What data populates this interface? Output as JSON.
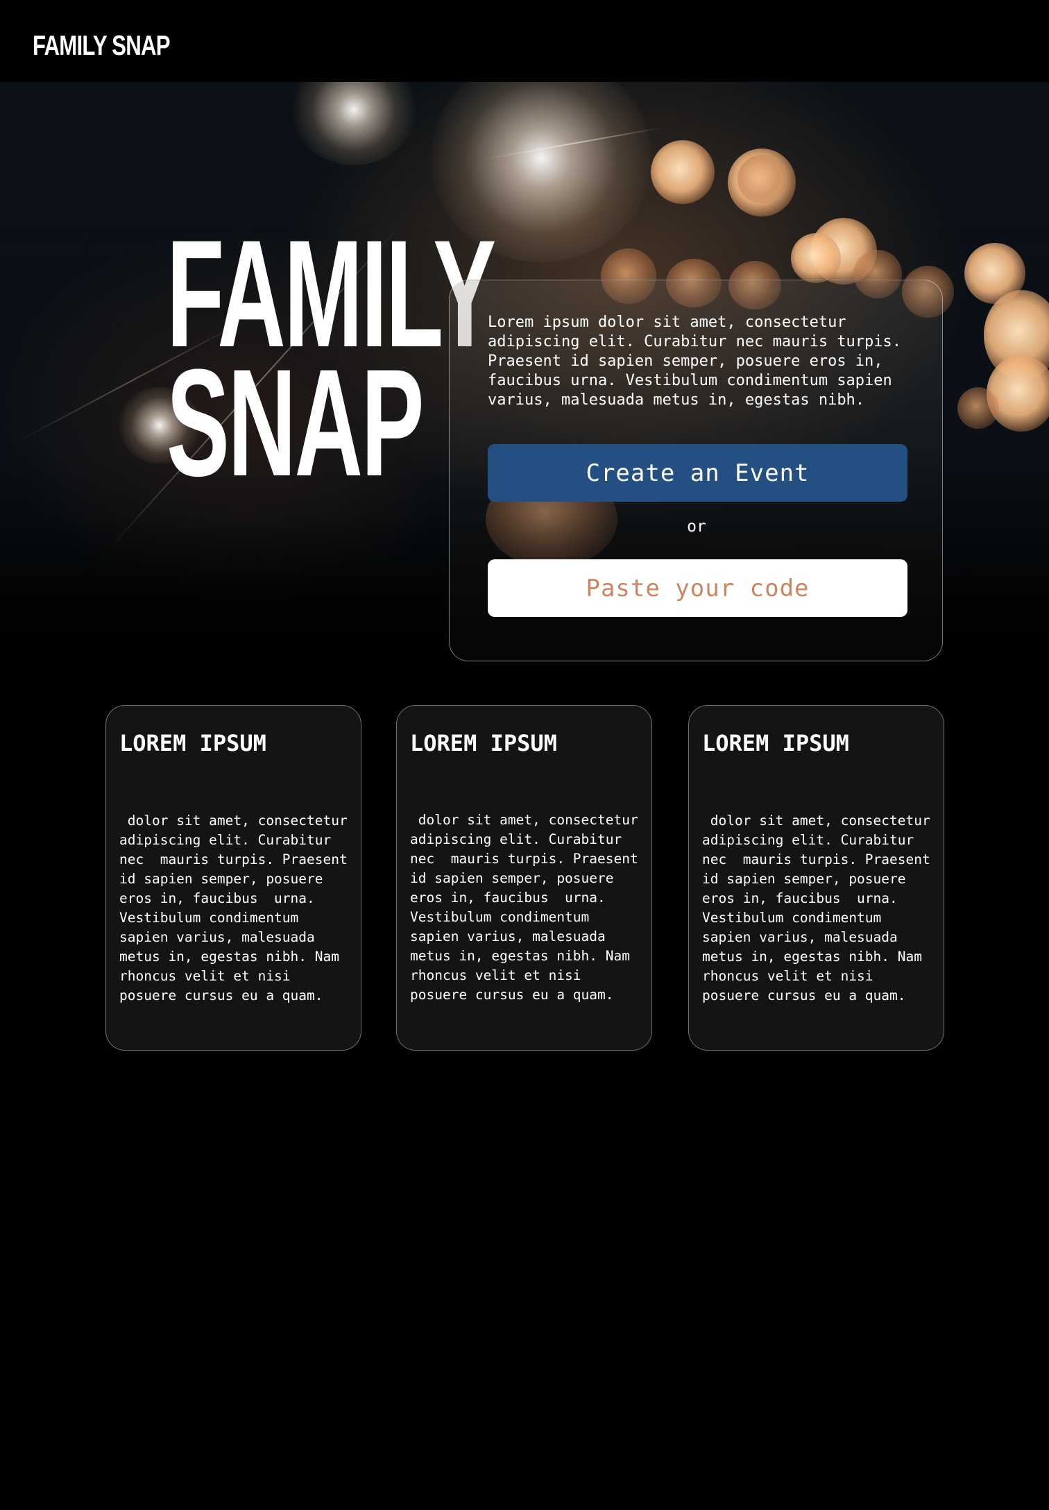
{
  "nav": {
    "logo": "FAMILY SNAP"
  },
  "hero": {
    "title_line1": "FAMILY",
    "title_line2": "SNAP",
    "intro": "Lorem ipsum dolor sit amet, consectetur adipiscing elit. Curabitur nec  mauris turpis. Praesent id sapien semper, posuere eros in, faucibus  urna. Vestibulum condimentum sapien varius, malesuada metus in, egestas  nibh.",
    "create_button": "Create an Event",
    "separator": "or",
    "code_placeholder": "Paste your code"
  },
  "features": [
    {
      "title": "LOREM IPSUM",
      "body": " dolor sit amet, consectetur adipiscing elit. Curabitur nec  mauris turpis. Praesent id sapien semper, posuere eros in, faucibus  urna. Vestibulum condimentum sapien varius, malesuada metus in, egestas nibh. Nam rhoncus velit et nisi posuere cursus eu a quam."
    },
    {
      "title": "LOREM IPSUM",
      "body": " dolor sit amet, consectetur adipiscing elit. Curabitur nec  mauris turpis. Praesent id sapien semper, posuere eros in, faucibus  urna. Vestibulum condimentum sapien varius, malesuada metus in, egestas nibh. Nam rhoncus velit et nisi posuere cursus eu a quam."
    },
    {
      "title": "LOREM IPSUM",
      "body": " dolor sit amet, consectetur adipiscing elit. Curabitur nec  mauris turpis. Praesent id sapien semper, posuere eros in, faucibus  urna. Vestibulum condimentum sapien varius, malesuada metus in, egestas nibh. Nam rhoncus velit et nisi posuere cursus eu a quam."
    }
  ],
  "colors": {
    "background": "#000000",
    "primary_button": "#244f82",
    "placeholder_text": "#cc8560",
    "card_background": "#141414"
  }
}
